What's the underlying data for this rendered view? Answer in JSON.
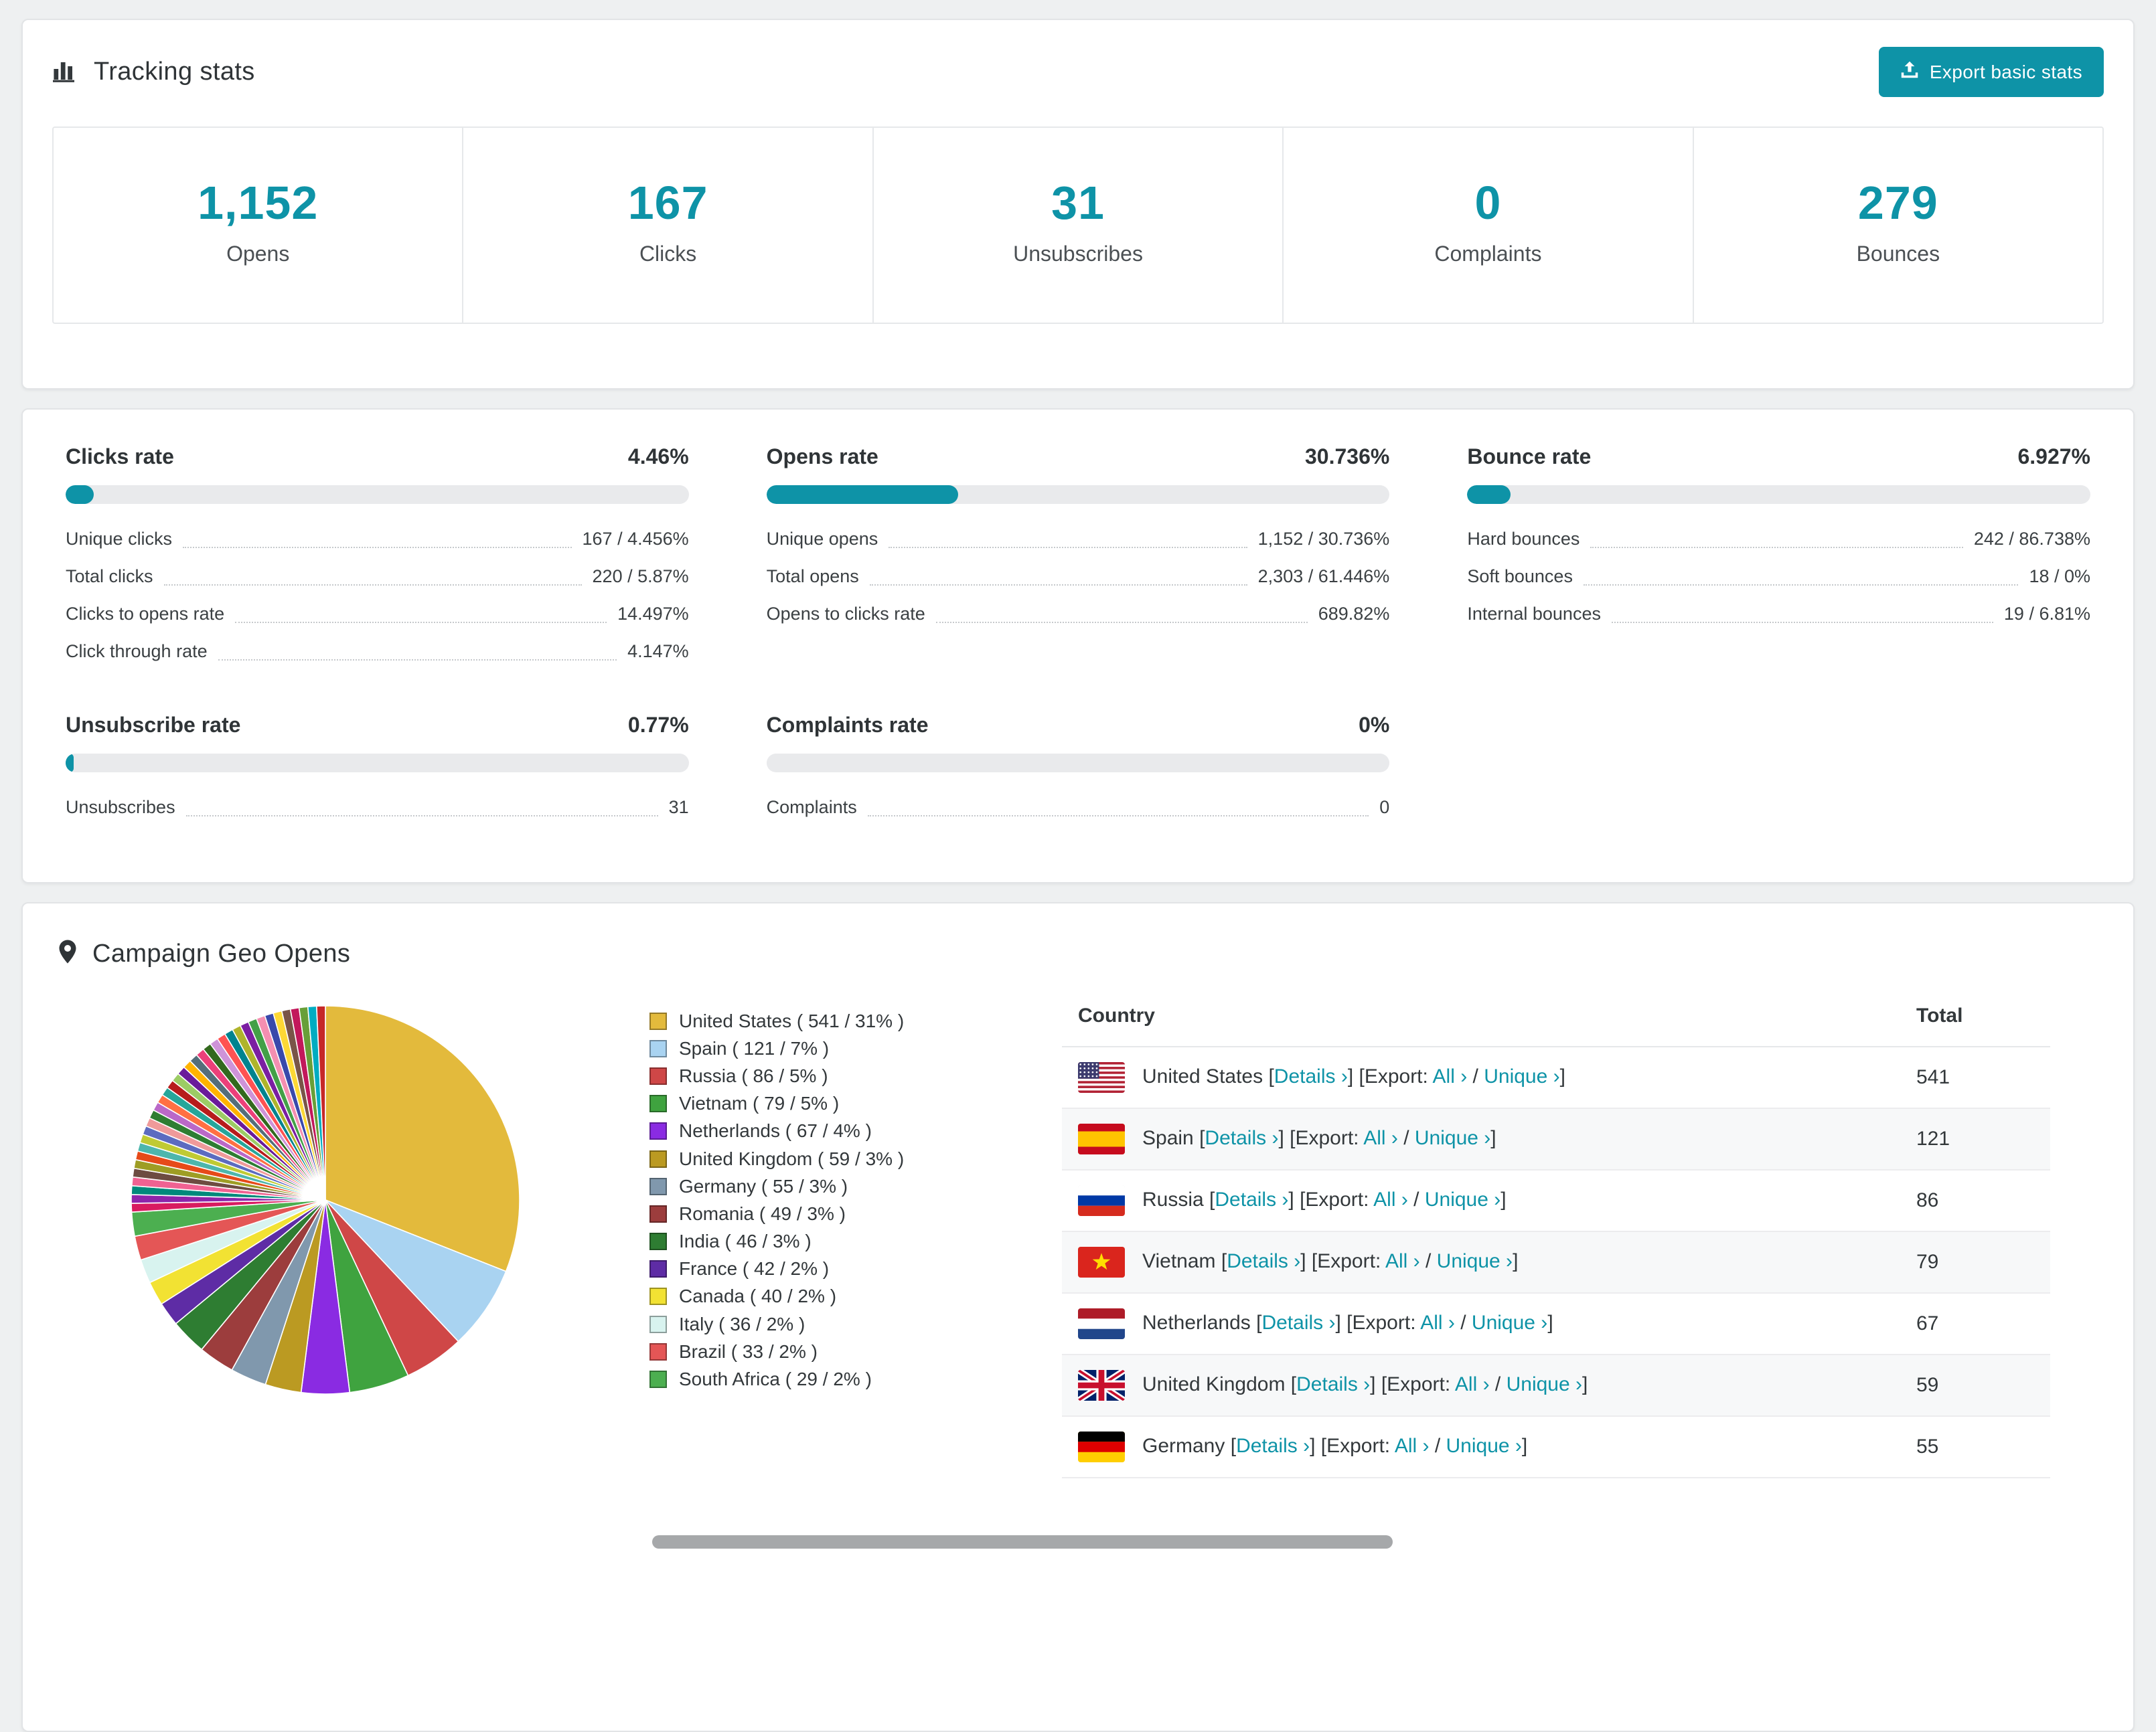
{
  "accent_color": "#0e93a7",
  "tracking": {
    "title": "Tracking stats",
    "export_button_label": "Export basic stats",
    "stats": [
      {
        "value": "1,152",
        "label": "Opens"
      },
      {
        "value": "167",
        "label": "Clicks"
      },
      {
        "value": "31",
        "label": "Unsubscribes"
      },
      {
        "value": "0",
        "label": "Complaints"
      },
      {
        "value": "279",
        "label": "Bounces"
      }
    ]
  },
  "rates": {
    "blocks": [
      {
        "title": "Clicks rate",
        "value": "4.46%",
        "percent": 4.46,
        "rows": [
          {
            "label": "Unique clicks",
            "value": "167 / 4.456%"
          },
          {
            "label": "Total clicks",
            "value": "220 / 5.87%"
          },
          {
            "label": "Clicks to opens rate",
            "value": "14.497%"
          },
          {
            "label": "Click through rate",
            "value": "4.147%"
          }
        ]
      },
      {
        "title": "Opens rate",
        "value": "30.736%",
        "percent": 30.736,
        "rows": [
          {
            "label": "Unique opens",
            "value": "1,152 / 30.736%"
          },
          {
            "label": "Total opens",
            "value": "2,303 / 61.446%"
          },
          {
            "label": "Opens to clicks rate",
            "value": "689.82%"
          }
        ]
      },
      {
        "title": "Bounce rate",
        "value": "6.927%",
        "percent": 6.927,
        "rows": [
          {
            "label": "Hard bounces",
            "value": "242 / 86.738%"
          },
          {
            "label": "Soft bounces",
            "value": "18 / 0%"
          },
          {
            "label": "Internal bounces",
            "value": "19 / 6.81%"
          }
        ]
      },
      {
        "title": "Unsubscribe rate",
        "value": "0.77%",
        "percent": 0.77,
        "rows": [
          {
            "label": "Unsubscribes",
            "value": "31"
          }
        ]
      },
      {
        "title": "Complaints rate",
        "value": "0%",
        "percent": 0,
        "rows": [
          {
            "label": "Complaints",
            "value": "0"
          }
        ]
      }
    ]
  },
  "geo": {
    "title": "Campaign Geo Opens",
    "table": {
      "headers": [
        "Country",
        "Total"
      ],
      "labels": {
        "bracket_open": "[",
        "bracket_close": "]",
        "details": "Details ›",
        "export": "Export:",
        "all": "All ›",
        "slash": "/",
        "unique": "Unique ›"
      },
      "rows": [
        {
          "country": "United States",
          "flag": "us",
          "total": "541"
        },
        {
          "country": "Spain",
          "flag": "es",
          "total": "121"
        },
        {
          "country": "Russia",
          "flag": "ru",
          "total": "86"
        },
        {
          "country": "Vietnam",
          "flag": "vn",
          "total": "79"
        },
        {
          "country": "Netherlands",
          "flag": "nl",
          "total": "67"
        },
        {
          "country": "United Kingdom",
          "flag": "gb",
          "total": "59"
        },
        {
          "country": "Germany",
          "flag": "de",
          "total": "55"
        }
      ]
    }
  },
  "chart_data": {
    "type": "pie",
    "title": "Campaign Geo Opens",
    "legend_position": "right",
    "legend_format": "{label} ( {count} / {pct}% )",
    "slices": [
      {
        "label": "United States",
        "count": 541,
        "pct": 31,
        "color": "#e3ba3c"
      },
      {
        "label": "Spain",
        "count": 121,
        "pct": 7,
        "color": "#a9d3f1"
      },
      {
        "label": "Russia",
        "count": 86,
        "pct": 5,
        "color": "#cf4747"
      },
      {
        "label": "Vietnam",
        "count": 79,
        "pct": 5,
        "color": "#3fa33f"
      },
      {
        "label": "Netherlands",
        "count": 67,
        "pct": 4,
        "color": "#8a2be2"
      },
      {
        "label": "United Kingdom",
        "count": 59,
        "pct": 3,
        "color": "#bb9a22"
      },
      {
        "label": "Germany",
        "count": 55,
        "pct": 3,
        "color": "#8098ad"
      },
      {
        "label": "Romania",
        "count": 49,
        "pct": 3,
        "color": "#9c3d3d"
      },
      {
        "label": "India",
        "count": 46,
        "pct": 3,
        "color": "#2e7d32"
      },
      {
        "label": "France",
        "count": 42,
        "pct": 2,
        "color": "#5e2ca5"
      },
      {
        "label": "Canada",
        "count": 40,
        "pct": 2,
        "color": "#f2e233"
      },
      {
        "label": "Italy",
        "count": 36,
        "pct": 2,
        "color": "#d8f3ef"
      },
      {
        "label": "Brazil",
        "count": 33,
        "pct": 2,
        "color": "#e45656"
      },
      {
        "label": "South Africa",
        "count": 29,
        "pct": 2,
        "color": "#4caf50"
      }
    ],
    "others_pct": 26,
    "others_colors": [
      "#d81b60",
      "#8e24aa",
      "#00897b",
      "#f06292",
      "#6d4c41",
      "#9e9d24",
      "#e64a19",
      "#4db6ac",
      "#c0ca33",
      "#5c6bc0",
      "#ef9a9a",
      "#2e7d32",
      "#ba68c8",
      "#ff7043",
      "#26a69a",
      "#b71c1c",
      "#9ccc65",
      "#6a1b9a",
      "#ffb300",
      "#546e7a",
      "#ec407a",
      "#33691e",
      "#ce93d8",
      "#ff5252",
      "#00838f",
      "#afb42b",
      "#7b1fa2",
      "#43a047",
      "#f48fb1",
      "#3949ab",
      "#fdd835",
      "#795548",
      "#c2185b",
      "#689f38",
      "#00acc1",
      "#c62828"
    ]
  }
}
